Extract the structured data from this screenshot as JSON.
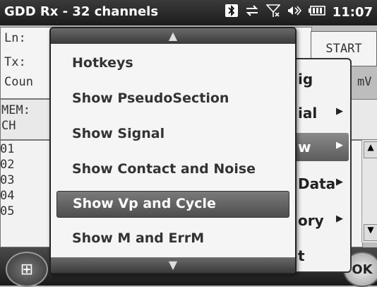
{
  "status": {
    "title": "GDD Rx - 32 channels",
    "bluetooth_icon": "bluetooth-icon",
    "sync_icon": "sync-icon",
    "signal_icon": "no-signal-icon",
    "volume_icon": "volume-icon",
    "battery_icon": "battery-icon",
    "time": "11:07"
  },
  "background": {
    "ln_label": "Ln:",
    "tx_label": "Tx:",
    "count_label": "Coun",
    "mem_label": "MEM:",
    "ch_label": "CH",
    "start_label": "START",
    "mv_label": "mV",
    "list": [
      "01",
      "02",
      "03",
      "04",
      "05"
    ]
  },
  "parent_menu": {
    "items": [
      {
        "label": "ig",
        "arrow": ""
      },
      {
        "label": "ial",
        "arrow": "▶"
      },
      {
        "label": "w",
        "arrow": "▶"
      },
      {
        "label": "Data",
        "arrow": "▶"
      },
      {
        "label": "ory",
        "arrow": "▶"
      },
      {
        "label": "t",
        "arrow": ""
      }
    ],
    "selected_index": 2
  },
  "menu": {
    "scroll_up": "▲",
    "scroll_down": "▼",
    "items": [
      "Hotkeys",
      "Show PseudoSection",
      "Show Signal",
      "Show Contact and Noise",
      "Show Vp and Cycle",
      "Show M and ErrM"
    ],
    "selected_index": 4
  },
  "bottom": {
    "ok_label": "OK",
    "start_icon": "windows-start-icon"
  },
  "colors": {
    "status_bg": "#1c1c1c",
    "menu_bg": "#f5f5f5",
    "selected_bg": "#5c5c5c"
  }
}
